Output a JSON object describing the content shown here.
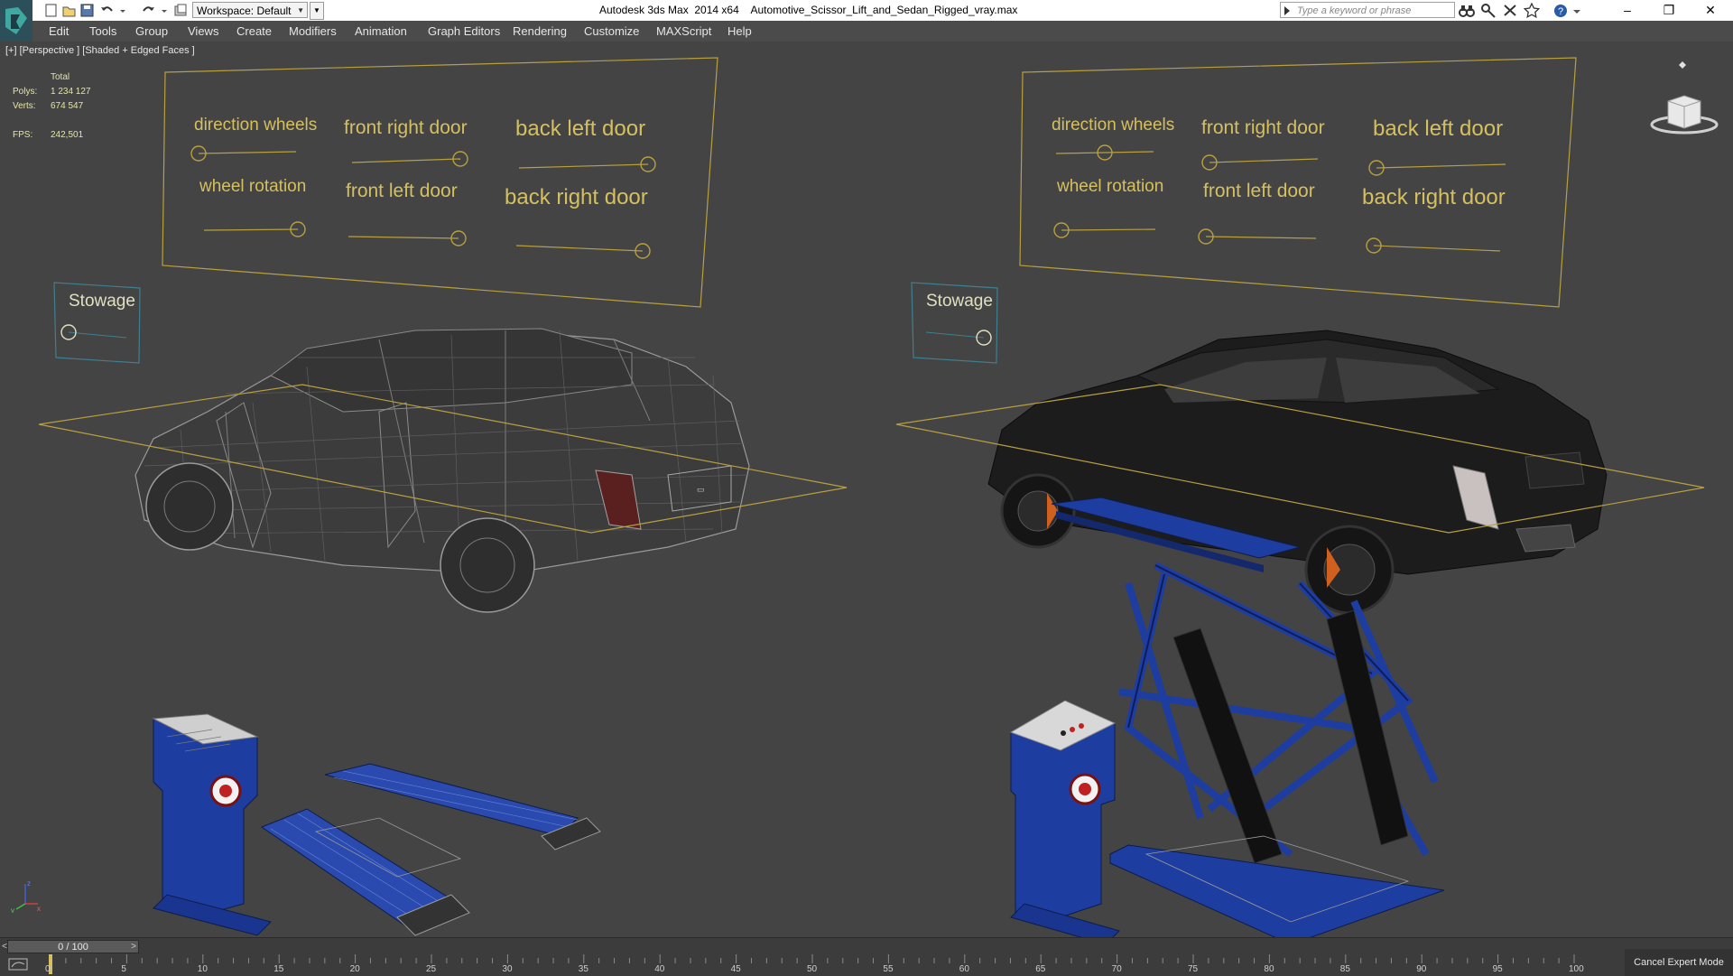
{
  "titlebar": {
    "app_name": "Autodesk 3ds Max  2014 x64",
    "file_name": "Automotive_Scissor_Lift_and_Sedan_Rigged_vray.max",
    "workspace": "Workspace: Default",
    "search_placeholder": "Type a keyword or phrase"
  },
  "menu": {
    "edit": "Edit",
    "tools": "Tools",
    "group": "Group",
    "views": "Views",
    "create": "Create",
    "modifiers": "Modifiers",
    "animation": "Animation",
    "graph_editors": "Graph Editors",
    "rendering": "Rendering",
    "customize": "Customize",
    "maxscript": "MAXScript",
    "help": "Help"
  },
  "viewport": {
    "label": "[+] [Perspective ] [Shaded + Edged Faces ]",
    "stats": {
      "total": "Total",
      "polys_label": "Polys:",
      "polys": "1 234 127",
      "verts_label": "Verts:",
      "verts": "674 547",
      "fps_label": "FPS:",
      "fps": "242,501"
    },
    "controls": {
      "direction_wheels": "direction wheels",
      "front_right_door": "front right door",
      "back_left_door": "back left door",
      "wheel_rotation": "wheel rotation",
      "front_left_door": "front left door",
      "back_right_door": "back right door",
      "stowage": "Stowage"
    },
    "slider_levels": {
      "left": {
        "direction_wheels": 0.0,
        "front_right_door": 1.0,
        "back_left_door": 1.0,
        "wheel_rotation": 1.0,
        "front_left_door": 1.0,
        "back_right_door": 1.0,
        "stowage": 0.0
      },
      "right": {
        "direction_wheels": 0.5,
        "front_right_door": 0.0,
        "back_left_door": 0.0,
        "wheel_rotation": 0.0,
        "front_left_door": 0.0,
        "back_right_door": 0.0,
        "stowage": 1.0
      }
    },
    "colors": {
      "control_frame": "#b8a040",
      "control_text": "#d4c060",
      "stowage_frame": "#3f7f8f",
      "lift_blue": "#1e3da0",
      "car_body": "#1c1c1c"
    }
  },
  "timeline": {
    "frame": "0 / 100",
    "ticks": [
      "0",
      "5",
      "10",
      "15",
      "20",
      "25",
      "30",
      "35",
      "40",
      "45",
      "50",
      "55",
      "60",
      "65",
      "70",
      "75",
      "80",
      "85",
      "90",
      "95",
      "100"
    ],
    "cancel_expert": "Cancel Expert Mode"
  }
}
